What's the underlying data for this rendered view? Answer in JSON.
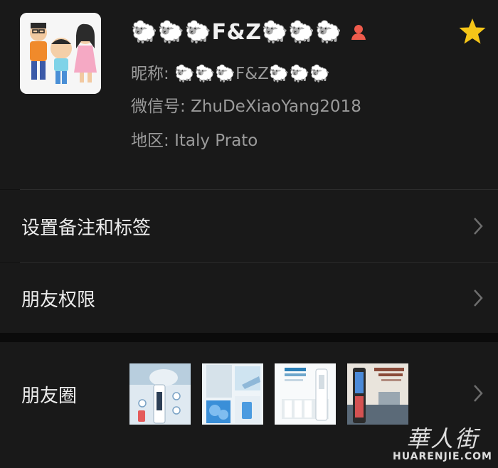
{
  "profile": {
    "name_prefix": "🐑🐑🐑",
    "name_core": "F&Z",
    "name_suffix": "🐑🐑🐑",
    "nickname_label": "昵称:",
    "nickname_value": "🐑🐑🐑F&Z🐑🐑🐑",
    "wechat_id_label": "微信号:",
    "wechat_id_value": "ZhuDeXiaoYang2018",
    "region_label": "地区:",
    "region_value": "Italy  Prato",
    "icons": {
      "gender": "female-user-icon",
      "star": "star-icon",
      "avatar": "cartoon-family-avatar"
    },
    "colors": {
      "star": "#f5c518",
      "gender": "#ef5b4c"
    }
  },
  "menu": {
    "remark_label": "设置备注和标签",
    "permission_label": "朋友权限",
    "moments_label": "朋友圈"
  },
  "moments_thumbs": [
    {
      "name": "moments-thumb-1",
      "caption": ""
    },
    {
      "name": "moments-thumb-2",
      "caption": ""
    },
    {
      "name": "moments-thumb-3",
      "caption": ""
    },
    {
      "name": "moments-thumb-4",
      "caption": ""
    }
  ],
  "watermark": {
    "cn": "華人街",
    "en": "HUARENJIE.COM"
  }
}
